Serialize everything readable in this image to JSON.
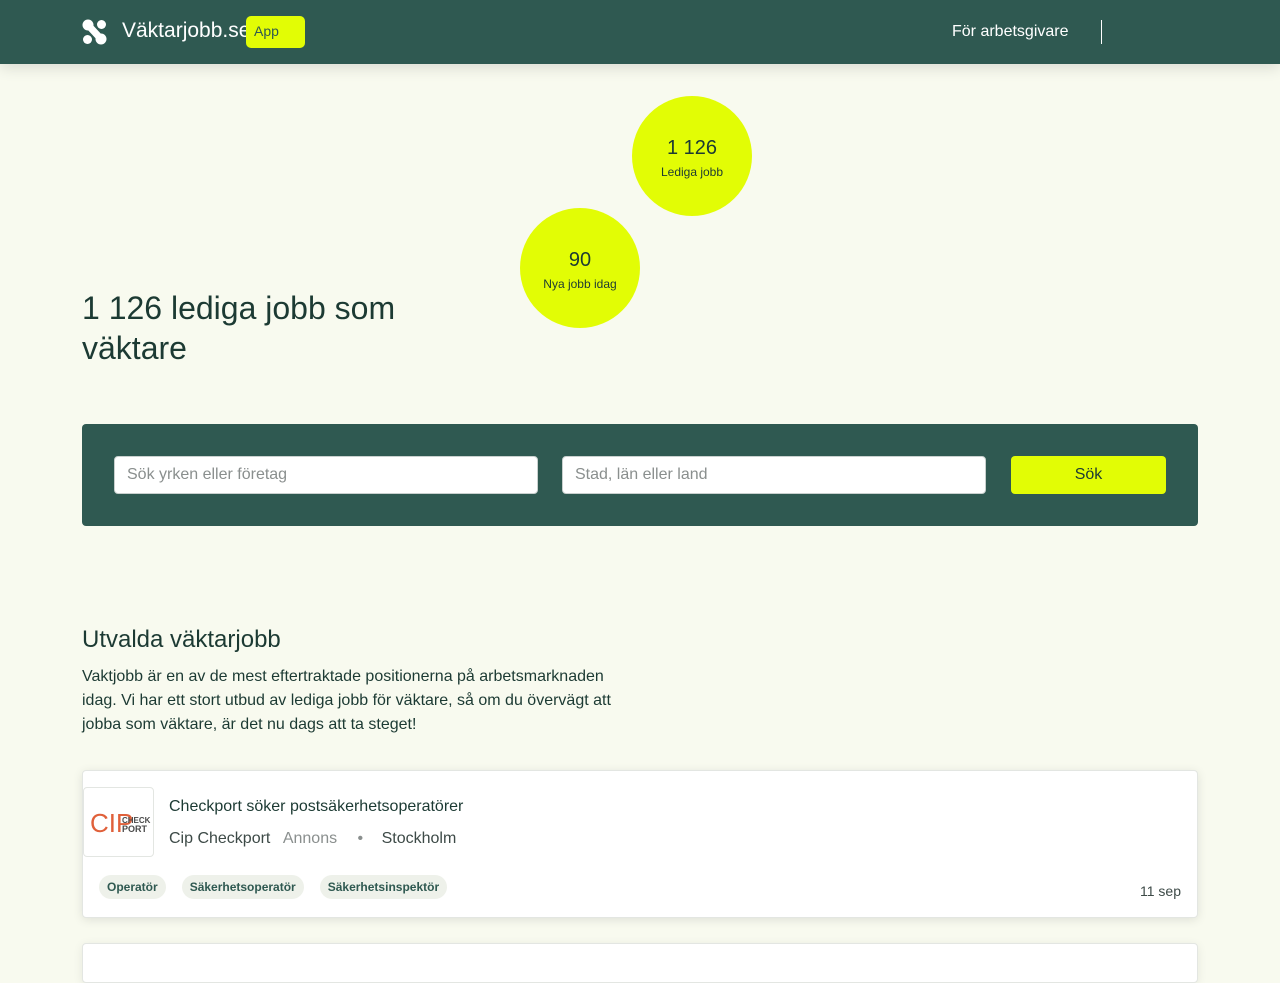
{
  "header": {
    "brand": "Väktarjobb.se",
    "app_badge": "App",
    "nav_employer": "För arbetsgivare",
    "logo_icon": "four-dot-logo-icon",
    "colors": {
      "bar": "#2f5951",
      "accent": "#e2fd05"
    }
  },
  "hero": {
    "title": "1 126 lediga jobb som väktare",
    "stats": [
      {
        "value": "1 126",
        "label": "Lediga jobb"
      },
      {
        "value": "90",
        "label": "Nya jobb idag"
      }
    ]
  },
  "search": {
    "query_placeholder": "Sök yrken eller företag",
    "location_placeholder": "Stad, län eller land",
    "button_label": "Sök"
  },
  "featured": {
    "title": "Utvalda väktarjobb",
    "description": "Vaktjobb är en av de mest eftertraktade positionerna på arbetsmarknaden idag. Vi har ett stort utbud av lediga jobb för väktare, så om du övervägt att jobba som väktare, är det nu dags att ta steget!"
  },
  "jobs": [
    {
      "title": "Checkport söker postsäkerhetsoperatörer",
      "company": "Cip Checkport",
      "ad_label": "Annons",
      "separator": "•",
      "location": "Stockholm",
      "tags": [
        "Operatör",
        "Säkerhetsoperatör",
        "Säkerhetsinspektör"
      ],
      "date": "11 sep",
      "logo": {
        "left": "CIP",
        "right_top": "CHECK",
        "right_bottom": "PORT"
      }
    }
  ]
}
